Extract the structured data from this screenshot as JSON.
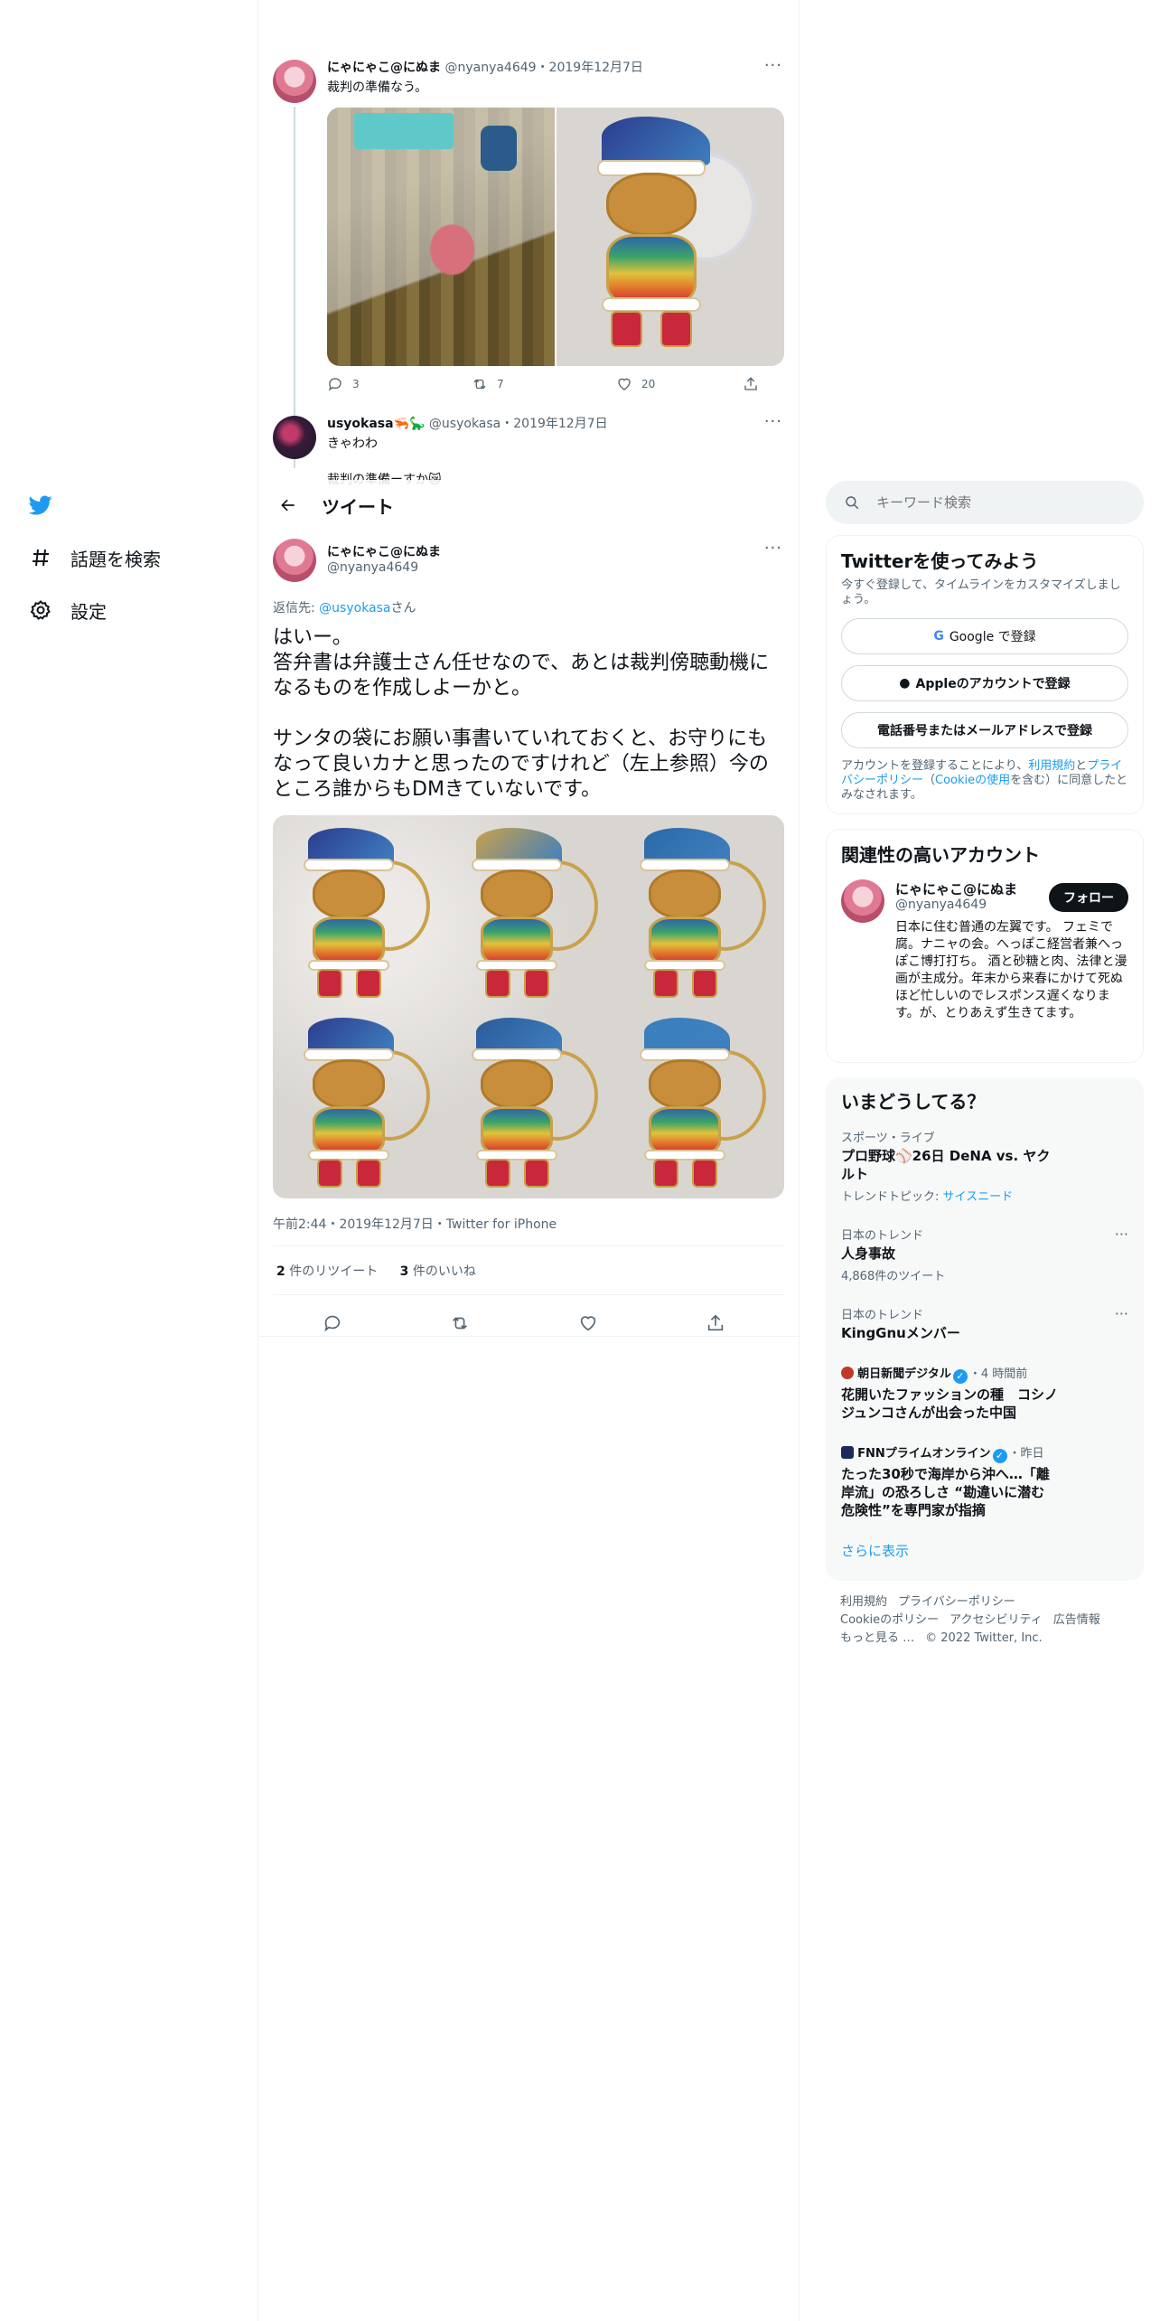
{
  "nav": {
    "items": [
      {
        "label": "話題を検索",
        "icon": "hashtag-icon"
      },
      {
        "label": "設定",
        "icon": "gear-icon"
      }
    ]
  },
  "parent_tweet": {
    "name": "にゃにゃこ@にぬま",
    "handle": "@nyanya4649",
    "date": "・2019年12月7日",
    "text": "裁判の準備なう。",
    "counts": {
      "reply": "3",
      "retweet": "7",
      "like": "20"
    }
  },
  "reply_tweet": {
    "name": "usyokasa",
    "emoji": "🦐🦕",
    "handle": "@usyokasa",
    "date": "・2019年12月7日",
    "line1": "きゃわわ",
    "line2": "裁判の準備ーすか😿"
  },
  "header": {
    "title": "ツイート"
  },
  "main_tweet": {
    "name": "にゃにゃこ@にぬま",
    "handle": "@nyanya4649",
    "reply_prefix": "返信先: ",
    "reply_to": "@usyokasa",
    "reply_suffix": "さん",
    "text": "はいー。\n答弁書は弁護士さん任せなので、あとは裁判傍聴動機になるものを作成しよーかと。\n\nサンタの袋にお願い事書いていれておくと、お守りにもなって良いカナと思ったのですけれど（左上参照）今のところ誰からもDMきていないです。",
    "meta": "午前2:44・2019年12月7日・Twitter for iPhone",
    "retweets_count": "2",
    "retweets_label": " 件のリツイート",
    "likes_count": "3",
    "likes_label": " 件のいいね"
  },
  "search": {
    "placeholder": "キーワード検索"
  },
  "signup": {
    "title": "Twitterを使ってみよう",
    "subtitle": "今すぐ登録して、タイムラインをカスタマイズしましょう。",
    "google": "Google で登録",
    "apple": "Appleのアカウントで登録",
    "phone": "電話番号またはメールアドレスで登録",
    "terms_pre": "アカウントを登録することにより、",
    "terms_link1": "利用規約",
    "terms_mid": "と",
    "terms_link2": "プライバシーポリシー",
    "terms_paren_open": "（",
    "terms_link3": "Cookieの使用",
    "terms_post": "を含む）に同意したとみなされます。"
  },
  "related": {
    "title": "関連性の高いアカウント",
    "name": "にゃにゃこ@にぬま",
    "handle": "@nyanya4649",
    "follow": "フォロー",
    "bio": "日本に住む普通の左翼です。 フェミで腐。ナニャの会。へっぽこ経営者兼へっぽこ博打打ち。 酒と砂糖と肉、法律と漫画が主成分。年末から来春にかけて死ぬほど忙しいのでレスポンス遅くなります。が、とりあえず生きてます。"
  },
  "trends": {
    "title": "いまどうしてる？",
    "items": [
      {
        "context": "スポーツ・ライブ",
        "title": "プロ野球⚾26日 DeNA vs. ヤクルト",
        "extra_label": "トレンドトピック: ",
        "extra_link": "サイスニード"
      },
      {
        "context": "日本のトレンド",
        "title": "人身事故",
        "extra_label": "4,868件のツイート"
      },
      {
        "context": "日本のトレンド",
        "title": "KingGnuメンバー"
      },
      {
        "source": "朝日新聞デジタル",
        "time": "・4 時間前",
        "title": "花開いたファッションの種　コシノジュンコさんが出会った中国"
      },
      {
        "source": "FNNプライムオンライン",
        "time": "・昨日",
        "title": "たった30秒で海岸から沖へ…「離岸流」の恐ろしさ “勘違いに潜む危険性”を専門家が指摘"
      }
    ],
    "show_more": "さらに表示"
  },
  "footer": {
    "links": [
      "利用規約",
      "プライバシーポリシー",
      "Cookieのポリシー",
      "アクセシビリティ",
      "広告情報",
      "もっと見る …"
    ],
    "copyright": "© 2022 Twitter, Inc."
  },
  "colors": {
    "accent": "#1d9bf0",
    "text": "#0f1419",
    "muted": "#536471",
    "border": "#eff3f4"
  }
}
